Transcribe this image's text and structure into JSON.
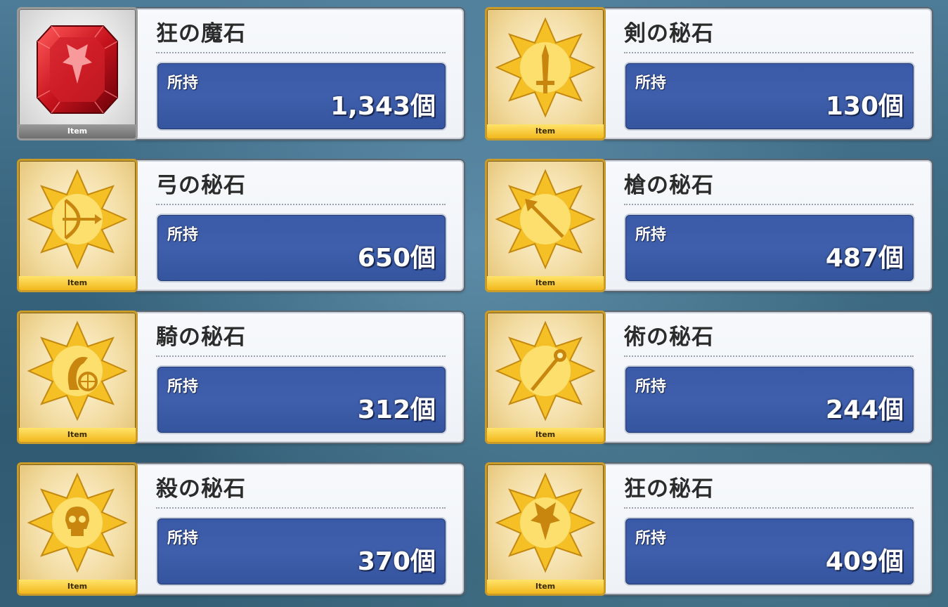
{
  "colors": {
    "gold_frame": "#c89b2a",
    "silver_frame": "#9a9a9a",
    "count_box_blue": "#3f5fac",
    "ruby": "#c8141e",
    "star_gold": "#f5c025"
  },
  "items": [
    {
      "name": "狂の魔石",
      "label": "所持",
      "count": "1,343個",
      "tag": "Item",
      "icon": "berserker-gem-icon",
      "frame": "silver"
    },
    {
      "name": "剣の秘石",
      "label": "所持",
      "count": "130個",
      "tag": "Item",
      "icon": "saber-secret-gem-icon",
      "frame": "gold"
    },
    {
      "name": "弓の秘石",
      "label": "所持",
      "count": "650個",
      "tag": "Item",
      "icon": "archer-secret-gem-icon",
      "frame": "gold"
    },
    {
      "name": "槍の秘石",
      "label": "所持",
      "count": "487個",
      "tag": "Item",
      "icon": "lancer-secret-gem-icon",
      "frame": "gold"
    },
    {
      "name": "騎の秘石",
      "label": "所持",
      "count": "312個",
      "tag": "Item",
      "icon": "rider-secret-gem-icon",
      "frame": "gold"
    },
    {
      "name": "術の秘石",
      "label": "所持",
      "count": "244個",
      "tag": "Item",
      "icon": "caster-secret-gem-icon",
      "frame": "gold"
    },
    {
      "name": "殺の秘石",
      "label": "所持",
      "count": "370個",
      "tag": "Item",
      "icon": "assassin-secret-gem-icon",
      "frame": "gold"
    },
    {
      "name": "狂の秘石",
      "label": "所持",
      "count": "409個",
      "tag": "Item",
      "icon": "berserker-secret-gem-icon",
      "frame": "gold"
    }
  ]
}
